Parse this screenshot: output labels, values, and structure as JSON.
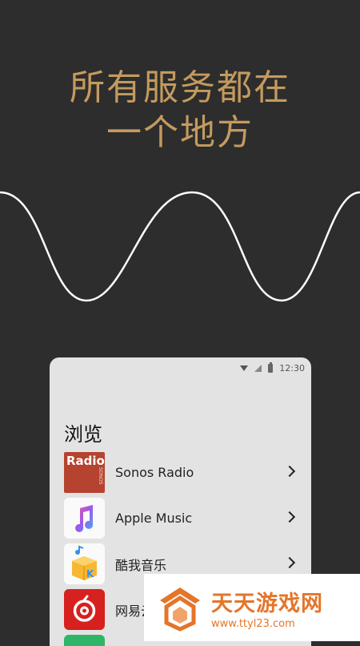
{
  "headline": {
    "line1": "所有服务都在",
    "line2": "一个地方"
  },
  "colors": {
    "background": "#2d2d2d",
    "accent": "#c49a5e",
    "wave": "#ffffff",
    "phone_bg": "#e3e3e3"
  },
  "phone": {
    "status": {
      "time": "12:30",
      "icons": [
        "wifi-icon",
        "signal-icon",
        "battery-icon"
      ]
    },
    "section_title": "浏览",
    "services": [
      {
        "name": "Sonos Radio",
        "icon": "sonos-radio-icon",
        "tile_text": "Radio",
        "tile_subtext": "SONOS"
      },
      {
        "name": "Apple Music",
        "icon": "apple-music-icon"
      },
      {
        "name": "酷我音乐",
        "icon": "kuwo-music-icon"
      },
      {
        "name": "网易云",
        "icon": "netease-music-icon"
      },
      {
        "name": "",
        "icon": "green-service-icon"
      }
    ]
  },
  "watermark": {
    "name": "天天游戏网",
    "url": "www.ttyl23.com"
  }
}
